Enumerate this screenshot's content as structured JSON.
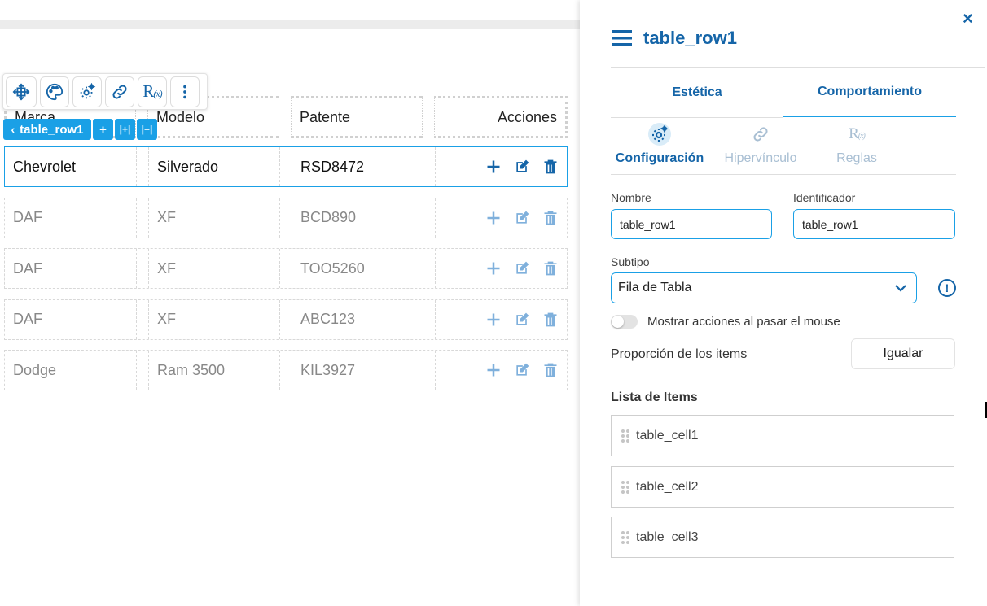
{
  "toolbar": {
    "items": [
      "move-icon",
      "palette-icon",
      "settings-gear-icon",
      "link-icon",
      "rules-icon",
      "more-vertical-icon"
    ],
    "rx_text": "R",
    "rx_sub": "(x)"
  },
  "selection_tag": {
    "label": "table_row1",
    "add": "+",
    "insert_col": "|+|",
    "remove_col": "|−|"
  },
  "table": {
    "columns": [
      "Marca",
      "Modelo",
      "Patente",
      "Acciones"
    ],
    "rows": [
      [
        "Chevrolet",
        "Silverado",
        "RSD8472"
      ],
      [
        "DAF",
        "XF",
        "BCD890"
      ],
      [
        "DAF",
        "XF",
        "TOO5260"
      ],
      [
        "DAF",
        "XF",
        "ABC123"
      ],
      [
        "Dodge",
        "Ram 3500",
        "KIL3927"
      ]
    ]
  },
  "panel": {
    "close": "×",
    "title": "table_row1",
    "tabs": [
      "Estética",
      "Comportamiento"
    ],
    "subtabs": [
      "Configuración",
      "Hipervínculo",
      "Reglas"
    ],
    "name_label": "Nombre",
    "name_value": "table_row1",
    "id_label": "Identificador",
    "id_value": "table_row1",
    "subtype_label": "Subtipo",
    "subtype_value": "Fila de Tabla",
    "info": "!",
    "toggle_label": "Mostrar acciones al pasar el mouse",
    "proportion_label": "Proporción de los items",
    "equalize_button": "Igualar",
    "items_title": "Lista de Items",
    "items": [
      "table_cell1",
      "table_cell2",
      "table_cell3"
    ]
  },
  "colors": {
    "accent": "#1565a8",
    "highlight": "#1aa0e6"
  }
}
